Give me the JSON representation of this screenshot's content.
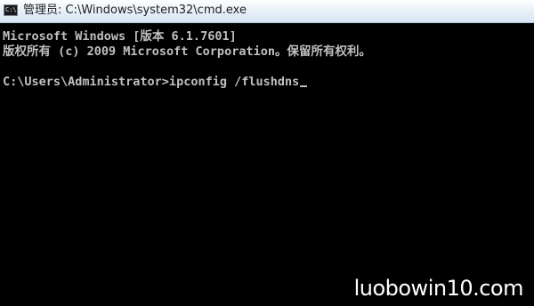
{
  "window": {
    "title": "管理员: C:\\Windows\\system32\\cmd.exe",
    "icon": "cmd-icon",
    "icon_glyph": "C:\\"
  },
  "console": {
    "lines": [
      "Microsoft Windows [版本 6.1.7601]",
      "版权所有 (c) 2009 Microsoft Corporation。保留所有权利。",
      "C:\\Users\\Administrator>ipconfig /flushdns"
    ],
    "colors": {
      "background": "#000000",
      "text": "#c0c0c0"
    }
  },
  "watermark": {
    "text": "luobowin10.com"
  }
}
